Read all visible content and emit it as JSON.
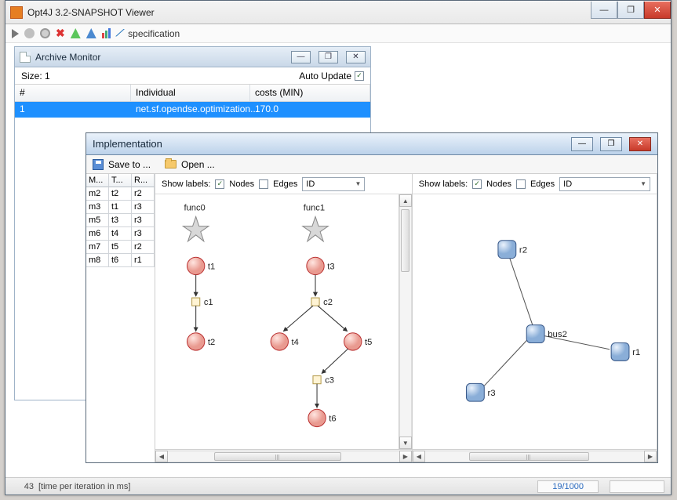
{
  "app": {
    "title": "Opt4J 3.2-SNAPSHOT Viewer"
  },
  "toolbar": {
    "specification_label": "specification"
  },
  "archive": {
    "title": "Archive Monitor",
    "size_label": "Size: 1",
    "auto_update_label": "Auto Update",
    "columns": {
      "col1": "#",
      "col2": "Individual",
      "col3": "costs (MIN)"
    },
    "rows": [
      {
        "num": "1",
        "individual": "net.sf.opendse.optimization...",
        "cost": "170.0"
      }
    ]
  },
  "impl": {
    "title": "Implementation",
    "save_label": "Save to ...",
    "open_label": "Open ...",
    "show_labels": "Show labels:",
    "nodes_label": "Nodes",
    "edges_label": "Edges",
    "select_value": "ID",
    "map_head": {
      "m": "M...",
      "t": "T...",
      "r": "R..."
    },
    "map_rows": [
      {
        "m": "m2",
        "t": "t2",
        "r": "r2"
      },
      {
        "m": "m3",
        "t": "t1",
        "r": "r3"
      },
      {
        "m": "m5",
        "t": "t3",
        "r": "r3"
      },
      {
        "m": "m6",
        "t": "t4",
        "r": "r3"
      },
      {
        "m": "m7",
        "t": "t5",
        "r": "r2"
      },
      {
        "m": "m8",
        "t": "t6",
        "r": "r1"
      }
    ],
    "func0": "func0",
    "func1": "func1",
    "task_graph_nodes": {
      "t1": "t1",
      "t2": "t2",
      "t3": "t3",
      "t4": "t4",
      "t5": "t5",
      "t6": "t6",
      "c1": "c1",
      "c2": "c2",
      "c3": "c3"
    },
    "res_graph_nodes": {
      "r1": "r1",
      "r2": "r2",
      "r3": "r3",
      "bus2": "bus2"
    }
  },
  "status": {
    "iter_time": "43",
    "iter_label": "[time per iteration in ms]",
    "progress": "19/1000"
  }
}
